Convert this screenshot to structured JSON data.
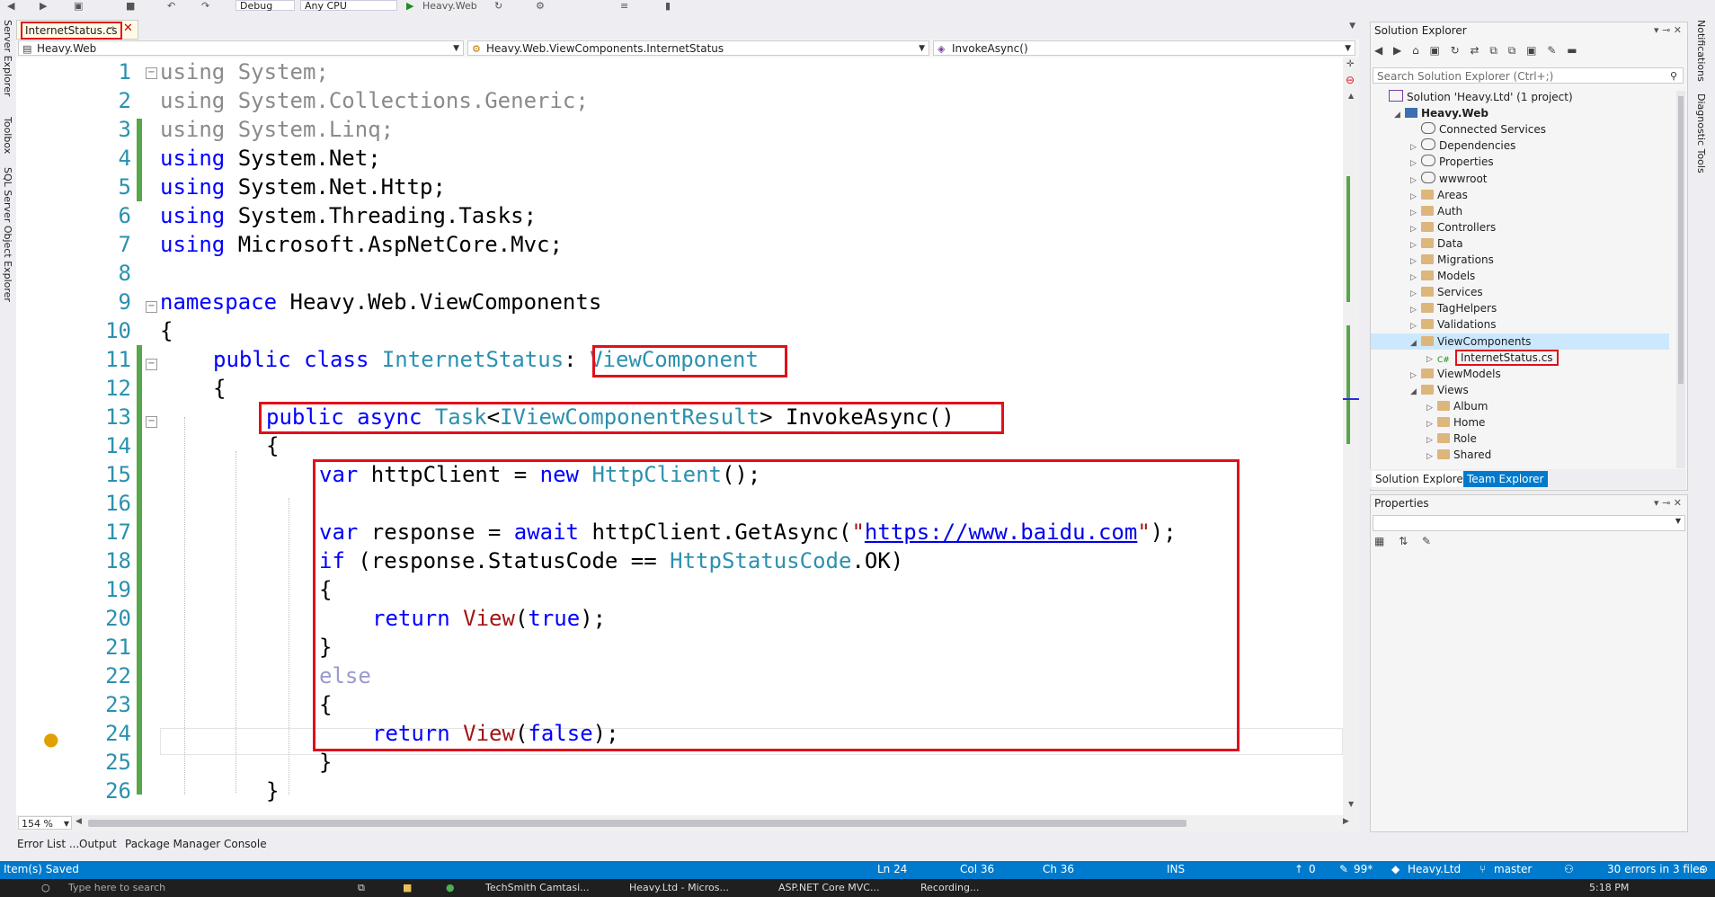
{
  "toolbar": {
    "config": "Debug",
    "platform": "Any CPU",
    "start_target": "Heavy.Web"
  },
  "left_strip": [
    "Server Explorer",
    "Toolbox",
    "SQL Server Object Explorer"
  ],
  "right_strip": [
    "Notifications",
    "Diagnostic Tools"
  ],
  "editor": {
    "tab_title": "InternetStatus.cs",
    "nav_project": "Heavy.Web",
    "nav_class": "Heavy.Web.ViewComponents.InternetStatus",
    "nav_member": "InvokeAsync()",
    "zoom": "154 %",
    "lines": [
      {
        "n": "1",
        "t": "using System;"
      },
      {
        "n": "2",
        "t": "using System.Collections.Generic;"
      },
      {
        "n": "3",
        "t": "using System.Linq;"
      },
      {
        "n": "4",
        "t": "using System.Net;"
      },
      {
        "n": "5",
        "t": "using System.Net.Http;"
      },
      {
        "n": "6",
        "t": "using System.Threading.Tasks;"
      },
      {
        "n": "7",
        "t": "using Microsoft.AspNetCore.Mvc;"
      },
      {
        "n": "8",
        "t": ""
      },
      {
        "n": "9",
        "t": "namespace Heavy.Web.ViewComponents"
      },
      {
        "n": "10",
        "t": "{"
      },
      {
        "n": "11",
        "t": "public class InternetStatus: ViewComponent"
      },
      {
        "n": "12",
        "t": "{"
      },
      {
        "n": "13",
        "t": "public async Task<IViewComponentResult> InvokeAsync()"
      },
      {
        "n": "14",
        "t": "{"
      },
      {
        "n": "15",
        "t": "var httpClient = new HttpClient();"
      },
      {
        "n": "16",
        "t": ""
      },
      {
        "n": "17",
        "t": "var response = await httpClient.GetAsync(\"https://www.baidu.com\");"
      },
      {
        "n": "18",
        "t": "if (response.StatusCode == HttpStatusCode.OK)"
      },
      {
        "n": "19",
        "t": "{"
      },
      {
        "n": "20",
        "t": "return View(true);"
      },
      {
        "n": "21",
        "t": "}"
      },
      {
        "n": "22",
        "t": "else"
      },
      {
        "n": "23",
        "t": "{"
      },
      {
        "n": "24",
        "t": "return View(false);"
      },
      {
        "n": "25",
        "t": "}"
      },
      {
        "n": "26",
        "t": "}"
      }
    ]
  },
  "bottom_tabs": [
    "Error List ...",
    "Output",
    "Package Manager Console"
  ],
  "solution_explorer": {
    "title": "Solution Explorer",
    "search_placeholder": "Search Solution Explorer (Ctrl+;)",
    "tree": [
      {
        "label": "Solution 'Heavy.Ltd' (1 project)",
        "depth": 0,
        "expander": "",
        "bold": false
      },
      {
        "label": "Heavy.Web",
        "depth": 1,
        "expander": "open",
        "bold": true
      },
      {
        "label": "Connected Services",
        "depth": 2,
        "expander": "",
        "bold": false
      },
      {
        "label": "Dependencies",
        "depth": 2,
        "expander": "closed",
        "bold": false
      },
      {
        "label": "Properties",
        "depth": 2,
        "expander": "closed",
        "bold": false
      },
      {
        "label": "wwwroot",
        "depth": 2,
        "expander": "closed",
        "bold": false
      },
      {
        "label": "Areas",
        "depth": 2,
        "expander": "closed",
        "bold": false
      },
      {
        "label": "Auth",
        "depth": 2,
        "expander": "closed",
        "bold": false
      },
      {
        "label": "Controllers",
        "depth": 2,
        "expander": "closed",
        "bold": false
      },
      {
        "label": "Data",
        "depth": 2,
        "expander": "closed",
        "bold": false
      },
      {
        "label": "Migrations",
        "depth": 2,
        "expander": "closed",
        "bold": false
      },
      {
        "label": "Models",
        "depth": 2,
        "expander": "closed",
        "bold": false
      },
      {
        "label": "Services",
        "depth": 2,
        "expander": "closed",
        "bold": false
      },
      {
        "label": "TagHelpers",
        "depth": 2,
        "expander": "closed",
        "bold": false
      },
      {
        "label": "Validations",
        "depth": 2,
        "expander": "closed",
        "bold": false
      },
      {
        "label": "ViewComponents",
        "depth": 2,
        "expander": "open",
        "bold": false
      },
      {
        "label": "InternetStatus.cs",
        "depth": 3,
        "expander": "closed",
        "bold": false
      },
      {
        "label": "ViewModels",
        "depth": 2,
        "expander": "closed",
        "bold": false
      },
      {
        "label": "Views",
        "depth": 2,
        "expander": "open",
        "bold": false
      },
      {
        "label": "Album",
        "depth": 3,
        "expander": "closed",
        "bold": false
      },
      {
        "label": "Home",
        "depth": 3,
        "expander": "closed",
        "bold": false
      },
      {
        "label": "Role",
        "depth": 3,
        "expander": "closed",
        "bold": false
      },
      {
        "label": "Shared",
        "depth": 3,
        "expander": "closed",
        "bold": false
      }
    ],
    "tabs": [
      "Solution Explorer",
      "Team Explorer"
    ]
  },
  "properties": {
    "title": "Properties"
  },
  "status_bar": {
    "message": "Item(s) Saved",
    "ln": "Ln 24",
    "col": "Col 36",
    "ch": "Ch 36",
    "mode": "INS",
    "pushes": "0",
    "pending": "99*",
    "repo": "Heavy.Ltd",
    "branch": "master",
    "errors": "30 errors in 3 files"
  },
  "taskbar": {
    "search": "Type here to search",
    "apps": [
      "TechSmith Camtasi...",
      "Heavy.Ltd - Micros...",
      "ASP.NET Core MVC...",
      "Recording..."
    ],
    "time": "5:18 PM"
  },
  "colors": {
    "accent": "#007acc",
    "highlight": "#e0101b",
    "keyword": "#0000ff",
    "type": "#2b91af"
  }
}
